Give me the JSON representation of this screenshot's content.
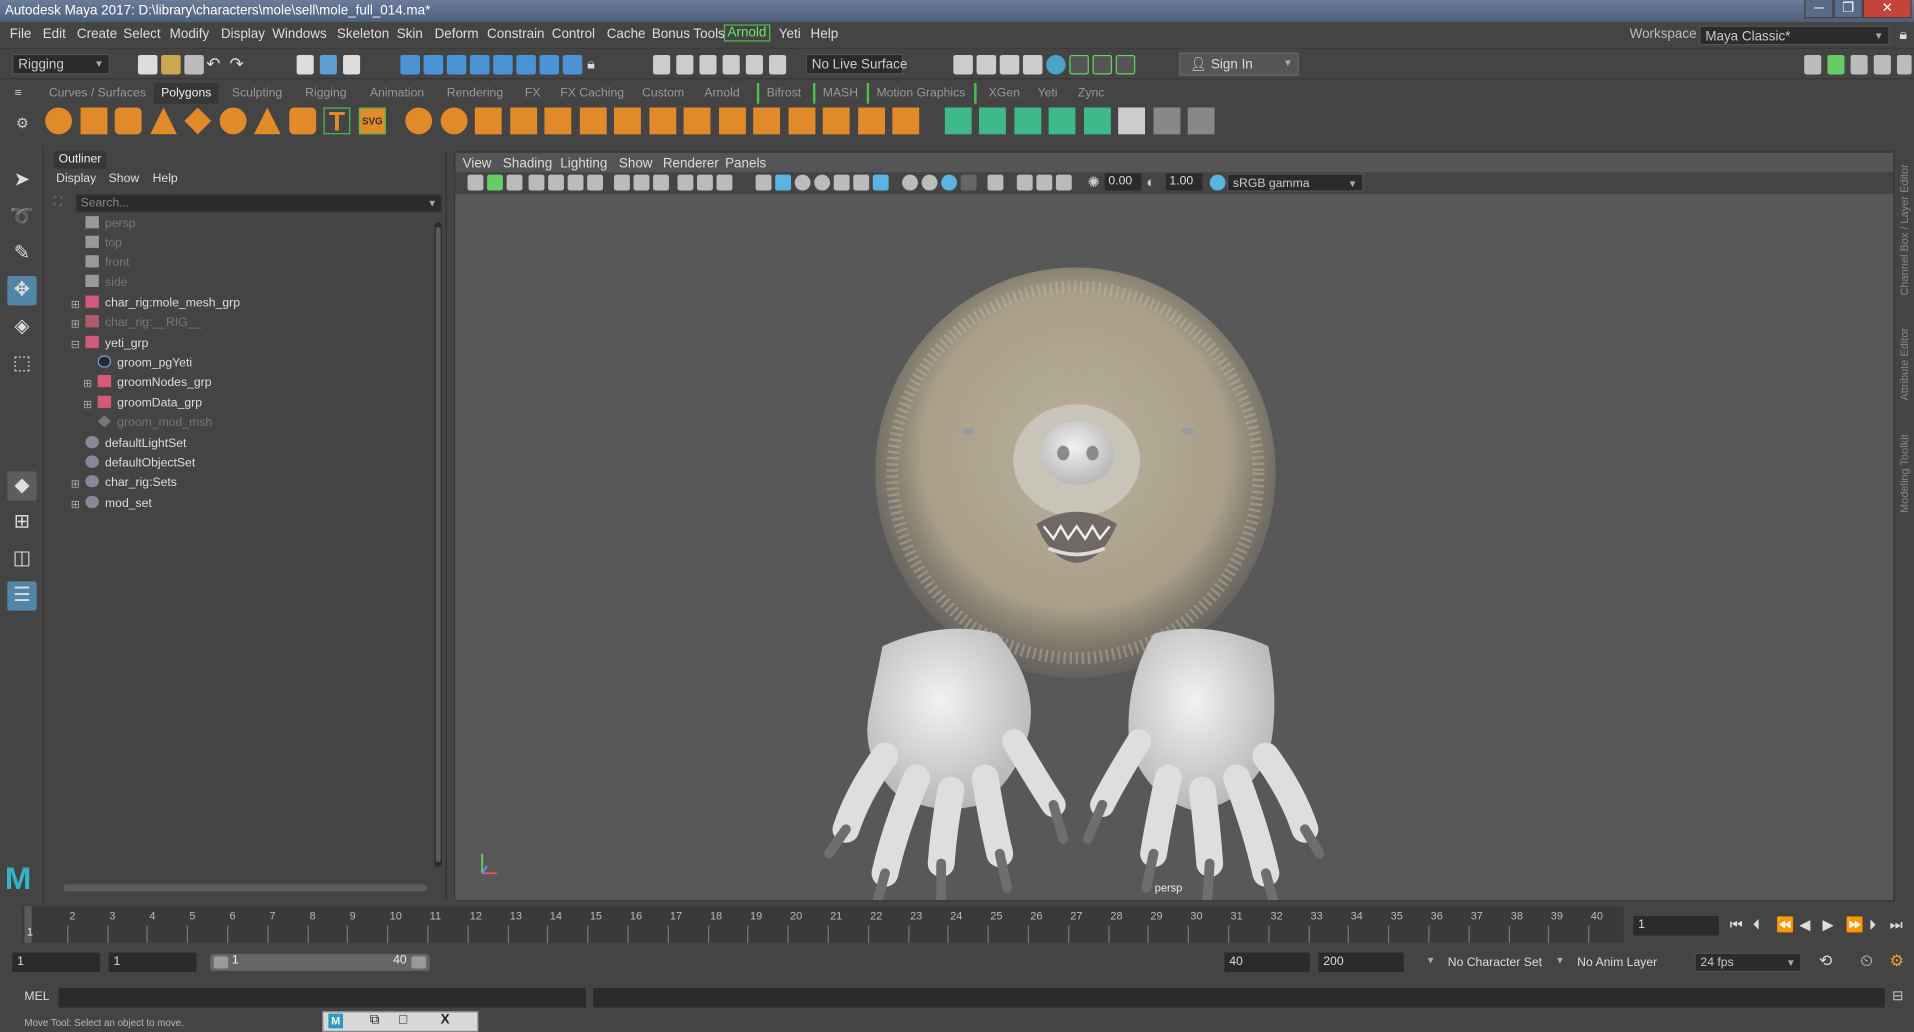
{
  "window": {
    "title": "Autodesk Maya 2017: D:\\library\\characters\\mole\\sell\\mole_full_014.ma*",
    "minimize": "─",
    "maximize": "❐",
    "close": "✕"
  },
  "menu": [
    "File",
    "Edit",
    "Create",
    "Select",
    "Modify",
    "Display",
    "Windows",
    "Skeleton",
    "Skin",
    "Deform",
    "Constrain",
    "Control",
    "Cache",
    "Bonus Tools",
    "Arnold",
    "Yeti",
    "Help"
  ],
  "workspace": {
    "label": "Workspace :",
    "value": "Maya Classic*"
  },
  "status": {
    "menuset": "Rigging",
    "live_surface": "No Live Surface",
    "sign_in": "Sign In"
  },
  "shelf_tabs": [
    "Curves / Surfaces",
    "Polygons",
    "Sculpting",
    "Rigging",
    "Animation",
    "Rendering",
    "FX",
    "FX Caching",
    "Custom",
    "Arnold",
    "Bifrost",
    "MASH",
    "Motion Graphics",
    "XGen",
    "Yeti",
    "Zync"
  ],
  "shelf_active": "Polygons",
  "outliner": {
    "title": "Outliner",
    "menus": [
      "Display",
      "Show",
      "Help"
    ],
    "search_placeholder": "Search...",
    "items": [
      {
        "label": "persp",
        "dim": true
      },
      {
        "label": "top",
        "dim": true
      },
      {
        "label": "front",
        "dim": true
      },
      {
        "label": "side",
        "dim": true
      },
      {
        "label": "char_rig:mole_mesh_grp",
        "dim": false
      },
      {
        "label": "char_rig:__RIG__",
        "dim": true
      },
      {
        "label": "yeti_grp",
        "dim": false
      },
      {
        "label": "groom_pgYeti",
        "dim": false
      },
      {
        "label": "groomNodes_grp",
        "dim": false
      },
      {
        "label": "groomData_grp",
        "dim": false
      },
      {
        "label": "groom_mod_msh",
        "dim": true
      },
      {
        "label": "defaultLightSet",
        "dim": false
      },
      {
        "label": "defaultObjectSet",
        "dim": false
      },
      {
        "label": "char_rig:Sets",
        "dim": false
      },
      {
        "label": "mod_set",
        "dim": false
      }
    ]
  },
  "viewport": {
    "menus": [
      "View",
      "Shading",
      "Lighting",
      "Show",
      "Renderer",
      "Panels"
    ],
    "near": "0.00",
    "gamma_value": "1.00",
    "colorspace": "sRGB gamma",
    "camera": "persp"
  },
  "right_panels": [
    "Channel Box / Layer Editor",
    "Attribute Editor",
    "Modeling Toolkit"
  ],
  "timeline": {
    "ticks": [
      "1",
      "2",
      "3",
      "4",
      "5",
      "6",
      "7",
      "8",
      "9",
      "10",
      "11",
      "12",
      "13",
      "14",
      "15",
      "16",
      "17",
      "18",
      "19",
      "20",
      "21",
      "22",
      "23",
      "24",
      "25",
      "26",
      "27",
      "28",
      "29",
      "30",
      "31",
      "32",
      "33",
      "34",
      "35",
      "36",
      "37",
      "38",
      "39",
      "40"
    ],
    "current_frame": "1",
    "playhead_label": "1"
  },
  "range": {
    "start": "1",
    "anim_start": "1",
    "slider_start": "1",
    "slider_end": "40",
    "end": "40",
    "anim_end": "200",
    "character_set": "No Character Set",
    "anim_layer": "No Anim Layer",
    "fps": "24 fps"
  },
  "command": {
    "language": "MEL"
  },
  "help_line": "Move Tool: Select an object to move.",
  "taskbar": {
    "maximize": "□",
    "close": "X"
  }
}
